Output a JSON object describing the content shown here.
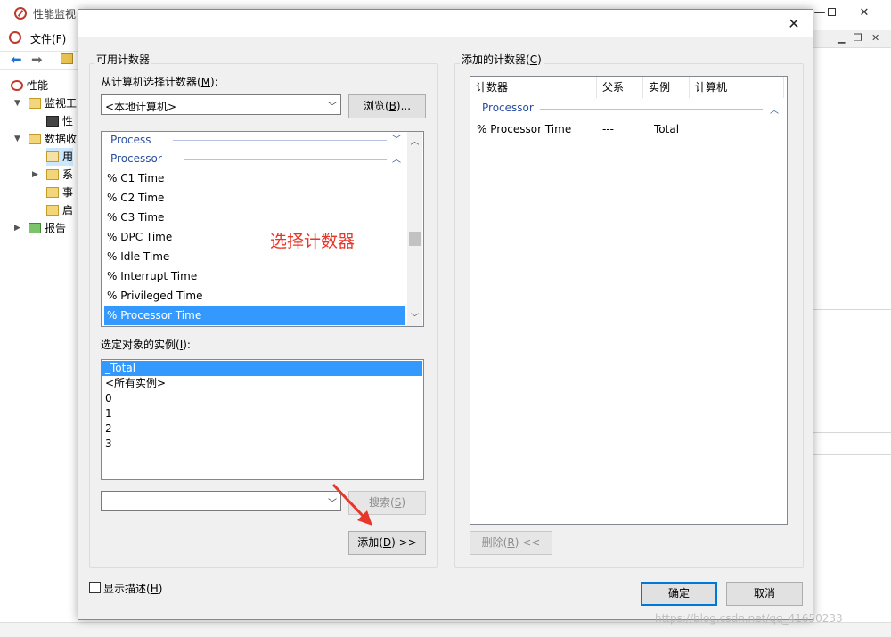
{
  "background_window": {
    "title": "性能监视",
    "menu_file": "文件(F)",
    "tree": [
      {
        "label": "性能"
      },
      {
        "label": "监视工"
      },
      {
        "label": "性"
      },
      {
        "label": "数据收"
      },
      {
        "label": "用"
      },
      {
        "label": "系"
      },
      {
        "label": "事"
      },
      {
        "label": "启"
      },
      {
        "label": "报告"
      }
    ]
  },
  "dialog": {
    "available_group_label": "可用计数器",
    "select_from_computer_label": "从计算机选择计数器(",
    "select_from_computer_key": "M",
    "select_from_computer_suffix": "):",
    "computer_value": "<本地计算机>",
    "browse_label": "浏览(",
    "browse_key": "B",
    "browse_suffix": ")...",
    "counter_groups": [
      {
        "label": "Process",
        "state": "collapsed"
      },
      {
        "label": "Processor",
        "state": "expanded"
      }
    ],
    "counters": [
      {
        "label": "% C1 Time",
        "selected": false
      },
      {
        "label": "% C2 Time",
        "selected": false
      },
      {
        "label": "% C3 Time",
        "selected": false
      },
      {
        "label": "% DPC Time",
        "selected": false
      },
      {
        "label": "% Idle Time",
        "selected": false
      },
      {
        "label": "% Interrupt Time",
        "selected": false
      },
      {
        "label": "% Privileged Time",
        "selected": false
      },
      {
        "label": "% Processor Time",
        "selected": true
      }
    ],
    "instances_label": "选定对象的实例(",
    "instances_key": "I",
    "instances_suffix": "):",
    "instances": [
      {
        "label": "_Total",
        "selected": true
      },
      {
        "label": "<所有实例>",
        "selected": false
      },
      {
        "label": "0",
        "selected": false
      },
      {
        "label": "1",
        "selected": false
      },
      {
        "label": "2",
        "selected": false
      },
      {
        "label": "3",
        "selected": false
      }
    ],
    "search_value": "",
    "search_label": "搜索(",
    "search_key": "S",
    "search_suffix": ")",
    "add_label": "添加(",
    "add_key": "D",
    "add_suffix": ") >>",
    "added_group_label": "添加的计数器(",
    "added_group_key": "C",
    "added_group_suffix": ")",
    "added_columns": [
      "计数器",
      "父系",
      "实例",
      "计算机"
    ],
    "added_group": "Processor",
    "added_rows": [
      {
        "counter": "% Processor Time",
        "parent": "---",
        "instance": "_Total",
        "computer": ""
      }
    ],
    "remove_label": "删除(",
    "remove_key": "R",
    "remove_suffix": ") <<",
    "show_description_label": "显示描述(",
    "show_description_key": "H",
    "show_description_suffix": ")",
    "show_description_checked": false,
    "ok_label": "确定",
    "cancel_label": "取消"
  },
  "annotation": {
    "note": "选择计数器",
    "color": "#e8362a"
  },
  "watermark": "https://blog.csdn.net/qq_41650233",
  "colors": {
    "selection": "#3399ff",
    "group_header": "#2b4ea0",
    "dialog_bg": "#f0f0f0"
  }
}
